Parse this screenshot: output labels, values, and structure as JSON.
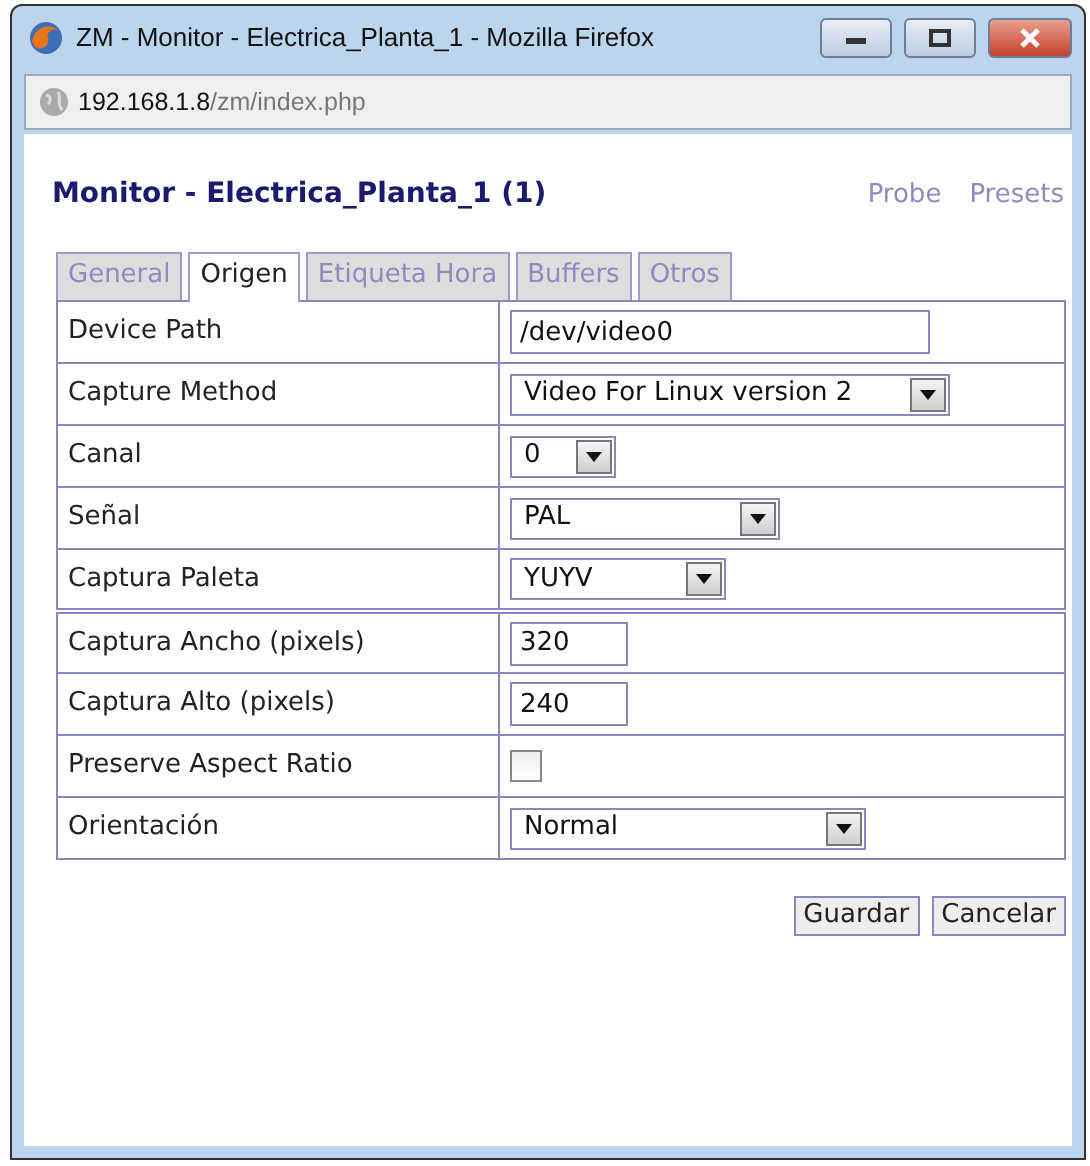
{
  "window": {
    "title": "ZM - Monitor - Electrica_Planta_1 - Mozilla Firefox"
  },
  "address_bar": {
    "host": "192.168.1.8",
    "path": "/zm/index.php"
  },
  "header": {
    "title": "Monitor - Electrica_Planta_1 (1)",
    "links": [
      "Probe",
      "Presets"
    ]
  },
  "tabs": [
    {
      "label": "General",
      "selected": false
    },
    {
      "label": "Origen",
      "selected": true
    },
    {
      "label": "Etiqueta Hora",
      "selected": false
    },
    {
      "label": "Buffers",
      "selected": false
    },
    {
      "label": "Otros",
      "selected": false
    }
  ],
  "fields": [
    {
      "label": "Device Path",
      "kind": "text",
      "value": "/dev/video0"
    },
    {
      "label": "Capture Method",
      "kind": "select",
      "value": "Video For Linux version 2"
    },
    {
      "label": "Canal",
      "kind": "select",
      "value": "0"
    },
    {
      "label": "Señal",
      "kind": "select",
      "value": "PAL"
    },
    {
      "label": "Captura Paleta",
      "kind": "select",
      "value": "YUYV"
    },
    {
      "label": "Captura Ancho (pixels)",
      "kind": "text",
      "value": "320"
    },
    {
      "label": "Captura Alto (pixels)",
      "kind": "text",
      "value": "240"
    },
    {
      "label": "Preserve Aspect Ratio",
      "kind": "checkbox",
      "checked": false
    },
    {
      "label": "Orientación",
      "kind": "select",
      "value": "Normal"
    }
  ],
  "buttons": [
    "Guardar",
    "Cancelar"
  ]
}
